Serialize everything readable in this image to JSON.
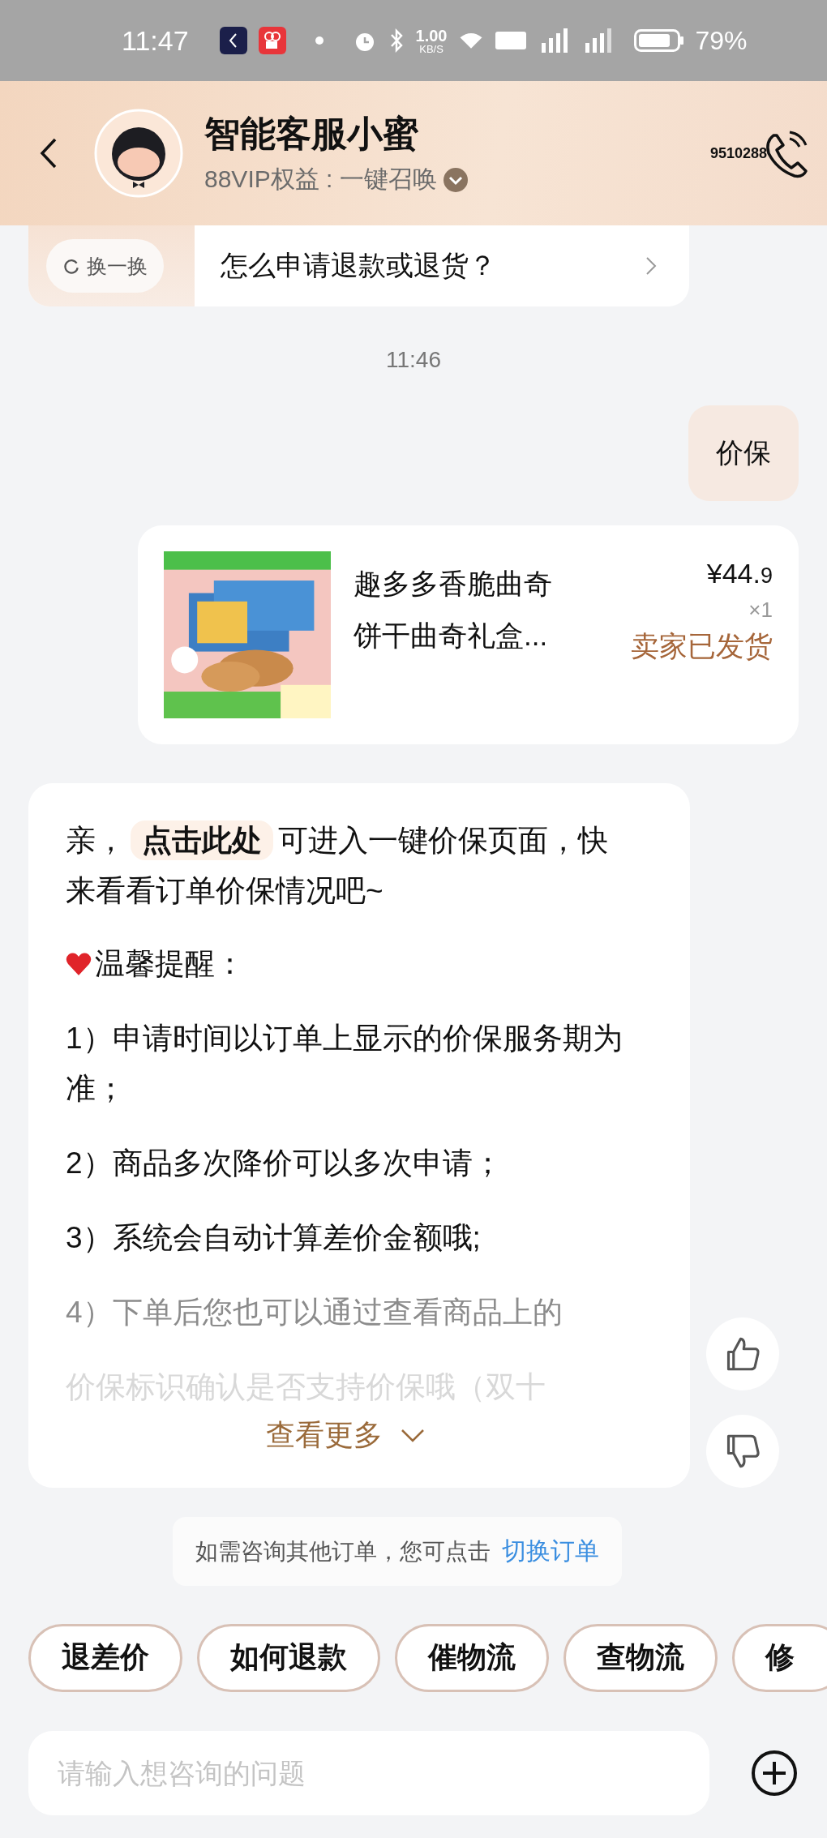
{
  "status_bar": {
    "time": "11:47",
    "speed": "1.00",
    "speed_unit": "KB/S",
    "battery": "79%"
  },
  "header": {
    "title": "智能客服小蜜",
    "subtitle": "88VIP权益 : 一键召唤",
    "phone": "9510288"
  },
  "suggestion": {
    "refresh": "换一换",
    "question": "怎么申请退款或退货？"
  },
  "timestamp": "11:46",
  "user_message": "价保",
  "order_card": {
    "name_line_1": "趣多多香脆曲奇",
    "name_line_2": "饼干曲奇礼盒...",
    "price": "¥44.",
    "price_decimal": "9",
    "quantity": "×1",
    "status": "卖家已发货"
  },
  "bot_message": {
    "intro_before": "亲，",
    "link": "点击此处",
    "intro_after": "可进入一键价保页面，快来看看订单价保情况吧~",
    "reminder": "温馨提醒：",
    "items": [
      {
        "text": "1）申请时间以订单上显示的价保服务期为准；",
        "faded": false
      },
      {
        "text": "2）商品多次降价可以多次申请；",
        "faded": false
      },
      {
        "text": "3）系统会自动计算差价金额哦;",
        "faded": false
      },
      {
        "text": "4）下单后您也可以通过查看商品上的",
        "faded": true
      },
      {
        "text": "价保标识确认是否支持价保哦（双十",
        "faded": true
      }
    ],
    "more": "查看更多"
  },
  "notice": {
    "text": "如需咨询其他订单，您可点击",
    "link": "切换订单"
  },
  "quick_replies": [
    "退差价",
    "如何退款",
    "催物流",
    "查物流",
    "修"
  ],
  "input": {
    "placeholder": "请输入想咨询的问题"
  }
}
